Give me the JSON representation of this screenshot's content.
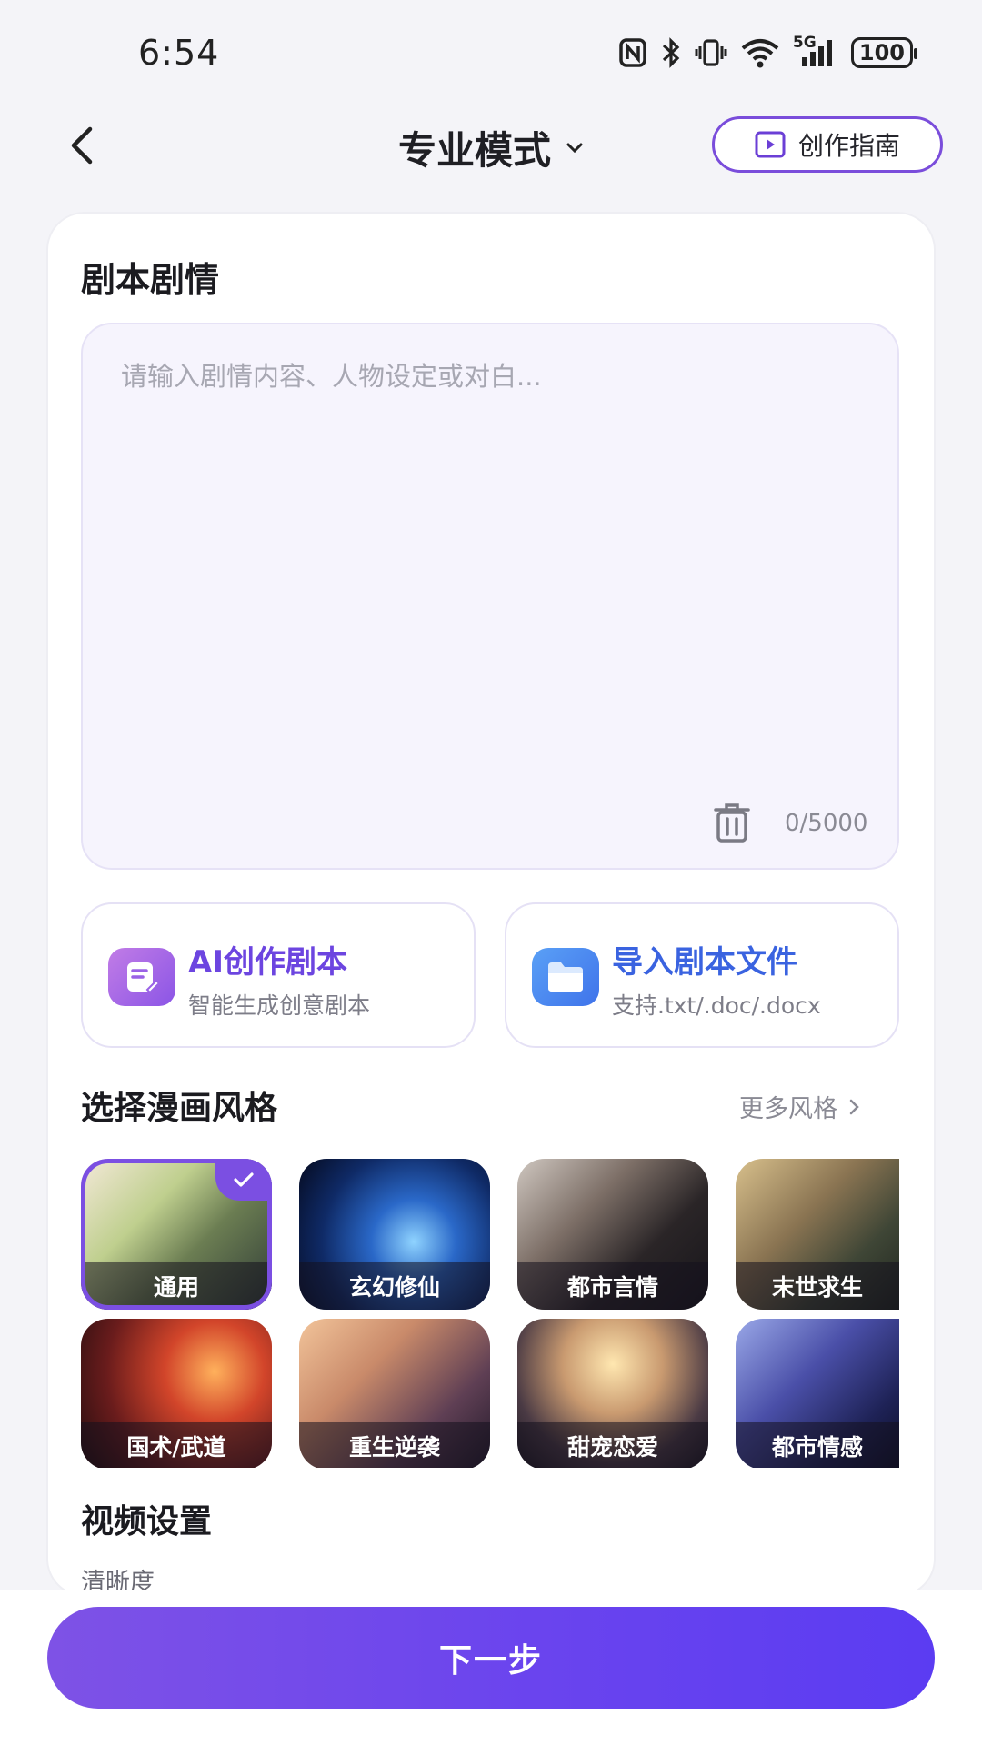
{
  "status_bar": {
    "time": "6:54",
    "signal_label": "5G",
    "battery": "100"
  },
  "header": {
    "title": "专业模式",
    "guide_button": "创作指南"
  },
  "script_section": {
    "title": "剧本剧情",
    "placeholder": "请输入剧情内容、人物设定或对白...",
    "counter": "0/5000"
  },
  "actions": [
    {
      "title": "AI创作剧本",
      "subtitle": "智能生成创意剧本",
      "icon": "note-edit-icon",
      "color": "#a66be8"
    },
    {
      "title": "导入剧本文件",
      "subtitle": "支持.txt/.doc/.docx",
      "icon": "folder-icon",
      "color": "#4a86f0"
    }
  ],
  "style_section": {
    "title": "选择漫画风格",
    "more_label": "更多风格",
    "styles": [
      {
        "label": "通用",
        "selected": true
      },
      {
        "label": "玄幻修仙",
        "selected": false
      },
      {
        "label": "都市言情",
        "selected": false
      },
      {
        "label": "末世求生",
        "selected": false
      },
      {
        "label": "国术/武道",
        "selected": false
      },
      {
        "label": "重生逆袭",
        "selected": false
      },
      {
        "label": "甜宠恋爱",
        "selected": false
      },
      {
        "label": "都市情感",
        "selected": false
      }
    ]
  },
  "video_section": {
    "title": "视频设置",
    "clarity_label": "清晰度"
  },
  "footer": {
    "next_button": "下一步"
  },
  "colors": {
    "accent": "#7b4fe2",
    "button_gradient_start": "#7e52e6",
    "button_gradient_end": "#5b3cf2"
  }
}
